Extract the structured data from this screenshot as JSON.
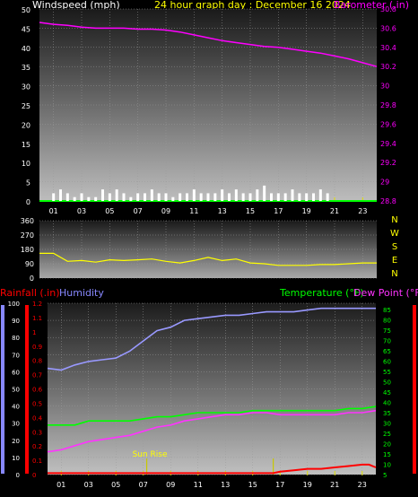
{
  "colors": {
    "background": "#000000",
    "white": "#ffffff",
    "yellow": "#ffff00",
    "magenta": "#ff00ff",
    "green": "#00ff00",
    "blue": "#8888ff",
    "red": "#ff0000",
    "lilac": "#9999ff",
    "pink": "#ff33ff",
    "tick_yellow": "#e0e000",
    "grid": "#9a9a9a"
  },
  "chart_data": [
    {
      "type": "line",
      "panel": "wind-baro",
      "title": "24 hour graph day : December 16 2024",
      "left_axis_label": "Windspeed (mph)",
      "right_axis_label": "Barometer (.in)",
      "x_ticks": [
        "01",
        "03",
        "05",
        "07",
        "09",
        "11",
        "13",
        "15",
        "17",
        "19",
        "21",
        "23"
      ],
      "x_range_hours": [
        0,
        24
      ],
      "left_axis": {
        "range": [
          0,
          50
        ],
        "ticks": [
          "0",
          "5",
          "10",
          "15",
          "20",
          "25",
          "30",
          "35",
          "40",
          "45",
          "50"
        ]
      },
      "right_axis": {
        "range": [
          28.8,
          30.8
        ],
        "ticks": [
          "28.8",
          "29",
          "29.2",
          "29.4",
          "29.6",
          "29.8",
          "30",
          "30.2",
          "30.4",
          "30.6",
          "30.8"
        ]
      },
      "series": [
        {
          "name": "Barometer",
          "axis": "right",
          "x": [
            0,
            1,
            2,
            3,
            4,
            5,
            6,
            7,
            8,
            9,
            10,
            11,
            12,
            13,
            14,
            15,
            16,
            17,
            18,
            19,
            20,
            21,
            22,
            23,
            24
          ],
          "y": [
            30.66,
            30.64,
            30.63,
            30.61,
            30.6,
            30.6,
            30.6,
            30.59,
            30.59,
            30.58,
            30.56,
            30.53,
            30.5,
            30.47,
            30.45,
            30.43,
            30.41,
            30.4,
            30.38,
            30.36,
            30.34,
            30.31,
            30.28,
            30.24,
            30.2
          ]
        },
        {
          "name": "Windspeed",
          "axis": "left",
          "type": "bar",
          "x": [
            1,
            1.5,
            2,
            2.5,
            3,
            3.5,
            4,
            4.5,
            5,
            5.5,
            6,
            6.5,
            7,
            7.5,
            8,
            8.5,
            9,
            9.5,
            10,
            10.5,
            11,
            11.5,
            12,
            12.5,
            13,
            13.5,
            14,
            14.5,
            15,
            15.5,
            16,
            16.5,
            17,
            17.5,
            18,
            18.5,
            19,
            19.5,
            20,
            20.5,
            21
          ],
          "y": [
            2,
            3,
            2,
            1,
            2,
            1,
            1,
            3,
            2,
            3,
            2,
            1,
            2,
            2,
            3,
            2,
            2,
            1,
            2,
            2,
            3,
            2,
            2,
            2,
            3,
            2,
            3,
            2,
            2,
            3,
            4,
            2,
            2,
            2,
            3,
            2,
            2,
            2,
            3,
            2,
            0
          ]
        }
      ]
    },
    {
      "type": "line",
      "panel": "wind-direction",
      "right_labels": [
        "N",
        "W",
        "S",
        "E",
        "N"
      ],
      "left_axis": {
        "range": [
          0,
          360
        ],
        "ticks": [
          "0",
          "90",
          "180",
          "270",
          "360"
        ]
      },
      "x_range_hours": [
        0,
        24
      ],
      "series": [
        {
          "name": "Wind direction",
          "x": [
            0,
            1,
            2,
            3,
            4,
            5,
            6,
            7,
            8,
            9,
            10,
            11,
            12,
            13,
            14,
            15,
            16,
            17,
            18,
            19,
            20,
            21,
            22,
            23,
            24
          ],
          "y": [
            155,
            155,
            105,
            110,
            100,
            115,
            110,
            115,
            120,
            105,
            95,
            110,
            130,
            110,
            120,
            95,
            90,
            80,
            80,
            80,
            85,
            85,
            90,
            95,
            95
          ]
        }
      ]
    },
    {
      "type": "line",
      "panel": "temp-hum-rain",
      "left_labels": {
        "rainfall": "Rainfall (.in)",
        "humidity": "Humidity"
      },
      "right_labels": {
        "temperature": "Temperature (°F)",
        "dewpoint": "Dew Point (°F)"
      },
      "annotation": "Sun Rise",
      "x_ticks": [
        "01",
        "03",
        "05",
        "07",
        "09",
        "11",
        "13",
        "15",
        "17",
        "19",
        "21",
        "23"
      ],
      "x_range_hours": [
        0,
        24
      ],
      "humidity_axis": {
        "range": [
          0,
          100
        ],
        "ticks": [
          "0",
          "10",
          "20",
          "30",
          "40",
          "50",
          "60",
          "70",
          "80",
          "90",
          "100"
        ]
      },
      "rain_axis": {
        "range": [
          0,
          1.2
        ],
        "ticks": [
          "0",
          "0.1",
          "0.2",
          "0.3",
          "0.4",
          "0.5",
          "0.6",
          "0.7",
          "0.8",
          "0.9",
          "1",
          "1.1",
          "1.2"
        ]
      },
      "temp_axis": {
        "range": [
          5,
          88
        ],
        "ticks": [
          "5",
          "10",
          "15",
          "20",
          "25",
          "30",
          "35",
          "40",
          "45",
          "50",
          "55",
          "60",
          "65",
          "70",
          "75",
          "80",
          "85"
        ]
      },
      "series": [
        {
          "name": "Humidity",
          "axis": "humidity",
          "x": [
            0,
            1,
            2,
            3,
            4,
            5,
            6,
            7,
            8,
            9,
            10,
            11,
            12,
            13,
            14,
            15,
            16,
            17,
            18,
            19,
            20,
            21,
            22,
            23,
            24
          ],
          "y": [
            62,
            61,
            64,
            66,
            67,
            68,
            72,
            78,
            84,
            86,
            90,
            91,
            92,
            93,
            93,
            94,
            95,
            95,
            95,
            96,
            97,
            97,
            97,
            97,
            97
          ]
        },
        {
          "name": "Temperature",
          "axis": "temp",
          "x": [
            0,
            1,
            2,
            3,
            4,
            5,
            6,
            7,
            8,
            9,
            10,
            11,
            12,
            13,
            14,
            15,
            16,
            17,
            18,
            19,
            20,
            21,
            22,
            23,
            24
          ],
          "y": [
            29,
            29,
            29,
            31,
            31,
            31,
            31,
            32,
            33,
            33,
            34,
            35,
            35,
            35,
            35,
            36,
            36,
            36,
            36,
            36,
            36,
            36,
            37,
            37,
            38
          ]
        },
        {
          "name": "Dew Point",
          "axis": "temp",
          "x": [
            0,
            1,
            2,
            3,
            4,
            5,
            6,
            7,
            8,
            9,
            10,
            11,
            12,
            13,
            14,
            15,
            16,
            17,
            18,
            19,
            20,
            21,
            22,
            23,
            24
          ],
          "y": [
            16,
            17,
            19,
            21,
            22,
            23,
            24,
            26,
            28,
            29,
            31,
            32,
            33,
            34,
            34,
            35,
            35,
            34,
            34,
            34,
            34,
            34,
            35,
            35,
            36
          ]
        },
        {
          "name": "Rainfall",
          "axis": "rain",
          "x": [
            0,
            16.5,
            17,
            18,
            19,
            20,
            21,
            22,
            23,
            23.5,
            24
          ],
          "y": [
            0.01,
            0.01,
            0.02,
            0.03,
            0.04,
            0.04,
            0.05,
            0.06,
            0.07,
            0.07,
            0.05
          ]
        }
      ],
      "sun_markers": [
        {
          "label": "Sun Rise",
          "hour": 7.25
        },
        {
          "label": "",
          "hour": 16.5
        }
      ]
    }
  ]
}
